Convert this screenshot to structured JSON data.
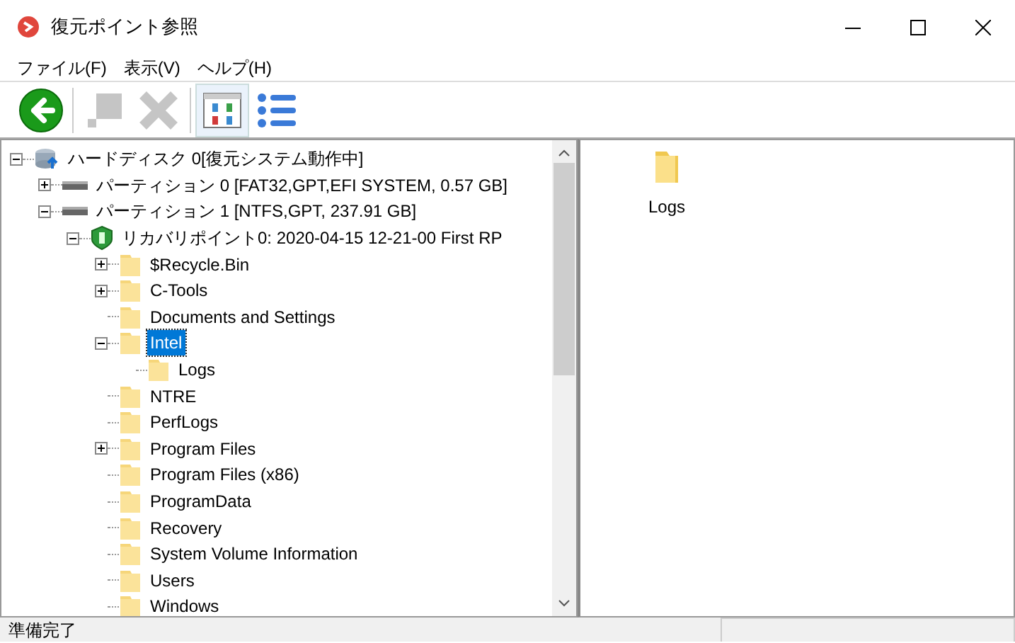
{
  "window": {
    "title": "復元ポイント参照"
  },
  "menu": [
    "ファイル(F)",
    "表示(V)",
    "ヘルプ(H)"
  ],
  "toolbar": [
    {
      "kind": "back",
      "disabled": false,
      "pressed": false
    },
    {
      "kind": "restore",
      "disabled": true,
      "pressed": false
    },
    {
      "kind": "delete",
      "disabled": true,
      "pressed": false
    },
    {
      "kind": "icons",
      "disabled": false,
      "pressed": true
    },
    {
      "kind": "list",
      "disabled": false,
      "pressed": false
    }
  ],
  "tree": [
    {
      "kind": "disk",
      "label": "ハードディスク 0[復元システム動作中]",
      "expanded": true,
      "selected": false,
      "children": [
        {
          "kind": "partition",
          "label": "パーティション 0 [FAT32,GPT,EFI SYSTEM, 0.57 GB]",
          "expanded": false,
          "selected": false
        },
        {
          "kind": "partition",
          "label": "パーティション 1 [NTFS,GPT, 237.91 GB]",
          "expanded": true,
          "selected": false,
          "children": [
            {
              "kind": "restore-point",
              "label": "リカバリポイント0:  2020-04-15 12-21-00  First RP",
              "expanded": true,
              "selected": false,
              "children": [
                {
                  "kind": "folder",
                  "label": "$Recycle.Bin",
                  "expanded": false,
                  "selected": false
                },
                {
                  "kind": "folder",
                  "label": "C-Tools",
                  "expanded": false,
                  "selected": false
                },
                {
                  "kind": "folder",
                  "label": "Documents and Settings",
                  "selected": false
                },
                {
                  "kind": "folder",
                  "label": "Intel",
                  "expanded": true,
                  "selected": true,
                  "children": [
                    {
                      "kind": "folder",
                      "label": "Logs",
                      "selected": false
                    }
                  ]
                },
                {
                  "kind": "folder",
                  "label": "NTRE",
                  "selected": false
                },
                {
                  "kind": "folder",
                  "label": "PerfLogs",
                  "selected": false
                },
                {
                  "kind": "folder",
                  "label": "Program Files",
                  "expanded": false,
                  "selected": false
                },
                {
                  "kind": "folder",
                  "label": "Program Files (x86)",
                  "selected": false
                },
                {
                  "kind": "folder",
                  "label": "ProgramData",
                  "selected": false
                },
                {
                  "kind": "folder",
                  "label": "Recovery",
                  "selected": false
                },
                {
                  "kind": "folder",
                  "label": "System Volume Information",
                  "selected": false
                },
                {
                  "kind": "folder",
                  "label": "Users",
                  "selected": false
                },
                {
                  "kind": "folder",
                  "label": "Windows",
                  "selected": false
                }
              ]
            }
          ]
        }
      ]
    }
  ],
  "contents": [
    {
      "label": "Logs"
    }
  ],
  "status_bar": "準備完了"
}
